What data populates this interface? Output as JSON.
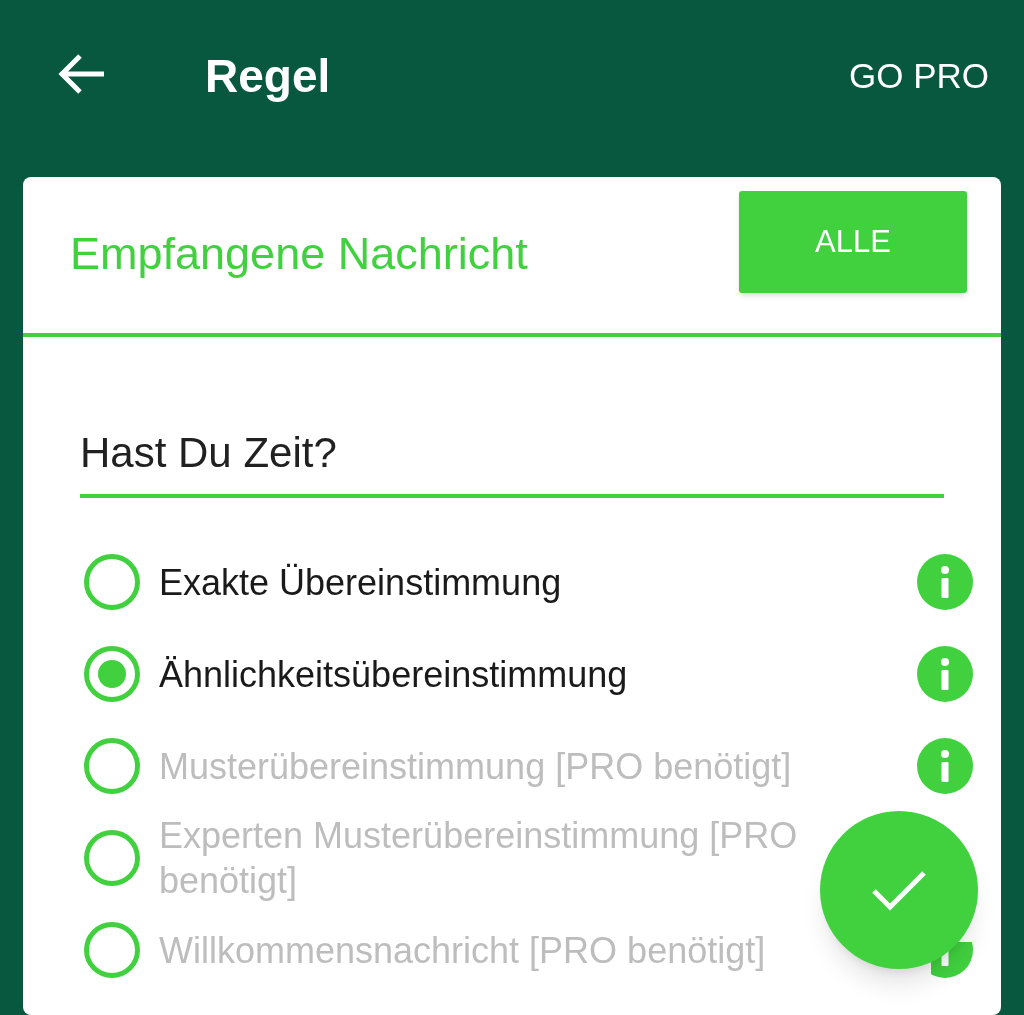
{
  "app_bar": {
    "title": "Regel",
    "action": "GO PRO"
  },
  "card": {
    "title": "Empfangene Nachricht",
    "button": "ALLE",
    "input": {
      "value": "Hast Du Zeit?"
    },
    "options": [
      {
        "label": "Exakte Übereinstimmung",
        "selected": false,
        "disabled": false,
        "info": true
      },
      {
        "label": "Ähnlichkeitsübereinstimmung",
        "selected": true,
        "disabled": false,
        "info": true
      },
      {
        "label": "Musterübereinstimmung [PRO benötigt]",
        "selected": false,
        "disabled": true,
        "info": true
      },
      {
        "label": "Experten Musterübereinstimmung [PRO benötigt]",
        "selected": false,
        "disabled": true,
        "info": false
      },
      {
        "label": "Willkommensnachricht [PRO benötigt]",
        "selected": false,
        "disabled": true,
        "info": true
      }
    ]
  }
}
